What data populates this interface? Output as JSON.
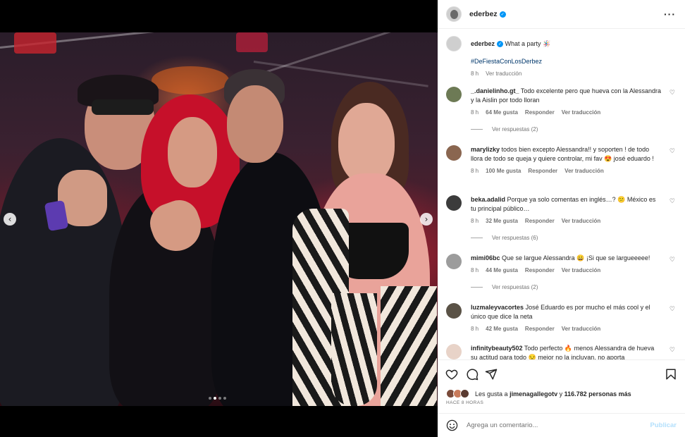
{
  "post": {
    "author": "ederbez",
    "caption_text": "What a party 🪅",
    "hashtag": "#DeFiestaConLosDerbez",
    "time": "8 h",
    "see_translation": "Ver traducción"
  },
  "comments": [
    {
      "username": "_.danielinho.gt_",
      "text": "Todo excelente pero que hueva con la Alessandra y la Aislin por todo lloran",
      "time": "8 h",
      "likes": "64 Me gusta",
      "reply": "Responder",
      "translate": "Ver traducción",
      "view_replies": "Ver respuestas (2)"
    },
    {
      "username": "marylizky",
      "text": "todos bien excepto Alessandra!! y soporten ! de todo llora de todo se queja y quiere controlar, mi fav 😍 josé eduardo !",
      "time": "8 h",
      "likes": "100 Me gusta",
      "reply": "Responder",
      "translate": "Ver traducción"
    },
    {
      "username": "beka.adalid",
      "text": "Porque ya solo comentas en inglés…? 😕 México es tu principal público…",
      "time": "8 h",
      "likes": "32 Me gusta",
      "reply": "Responder",
      "translate": "Ver traducción",
      "view_replies": "Ver respuestas (6)"
    },
    {
      "username": "mimi06bc",
      "text": "Que se largue Alessandra 😀 ¡Si que se largueeeee!",
      "time": "8 h",
      "likes": "44 Me gusta",
      "reply": "Responder",
      "translate": "Ver traducción",
      "view_replies": "Ver respuestas (2)"
    },
    {
      "username": "luzmaleyvacortes",
      "text": "José Eduardo es por mucho el más cool y el único que dice la neta",
      "time": "8 h",
      "likes": "42 Me gusta",
      "reply": "Responder",
      "translate": "Ver traducción"
    },
    {
      "username": "infinitybeauty502",
      "text": "Todo perfecto 🔥 menos Alessandra de hueva su actitud para todo 😒 mejor no la incluyan, no aporta",
      "time": "",
      "likes": "",
      "reply": "",
      "translate": ""
    }
  ],
  "likes": {
    "prefix": "Les gusta a",
    "user": "jimenagallegotv",
    "connector": "y",
    "count": "116.782 personas más"
  },
  "timestamp": "HACE 8 HORAS",
  "composer": {
    "placeholder": "Agrega un comentario...",
    "publish": "Publicar"
  },
  "carousel": {
    "slide_index": 2,
    "slide_count": 4
  },
  "icons": {
    "more": "more-horizontal-icon",
    "like": "heart-icon",
    "comment": "comment-icon",
    "share": "share-icon",
    "save": "bookmark-icon",
    "emoji": "emoji-icon",
    "prev": "chevron-left-icon",
    "next": "chevron-right-icon"
  },
  "colors": {
    "accent": "#0095f6",
    "link": "#00376b",
    "publish_disabled": "#b2dffc"
  }
}
